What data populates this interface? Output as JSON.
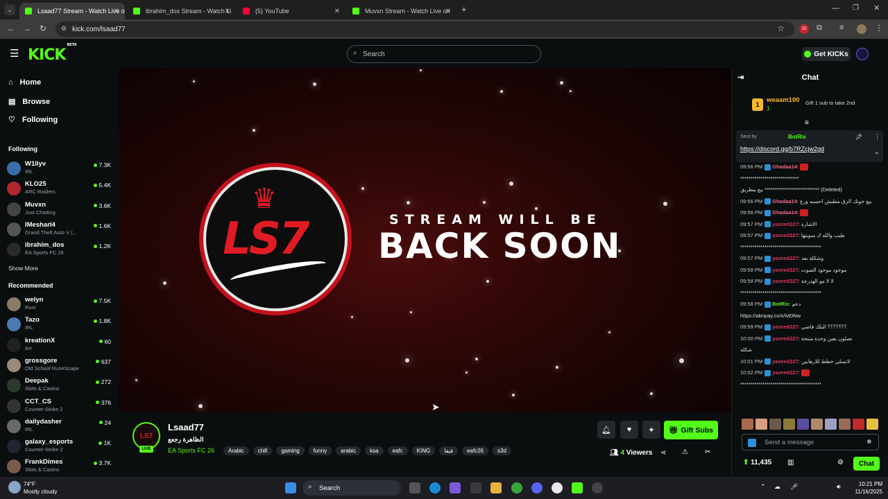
{
  "browser": {
    "tabs": [
      {
        "title": "Lsaad77 Stream - Watch Live o",
        "active": true,
        "favicon_color": "#53fc18"
      },
      {
        "title": "ibrahim_dos Stream - Watch Li",
        "active": false,
        "favicon_color": "#53fc18"
      },
      {
        "title": "(5) YouTube",
        "active": false,
        "favicon_color": "#ff0033"
      },
      {
        "title": "Muvxn Stream - Watch Live on",
        "active": false,
        "favicon_color": "#53fc18"
      }
    ],
    "url": "kick.com/lsaad77",
    "ext_badge": "20"
  },
  "header": {
    "logo": "KICK",
    "logo_sup": "BETA",
    "search_placeholder": "Search",
    "get_kicks": "Get KICKs"
  },
  "sidebar": {
    "nav": [
      {
        "label": "Home",
        "icon": "home-icon"
      },
      {
        "label": "Browse",
        "icon": "browse-icon"
      },
      {
        "label": "Following",
        "icon": "heart-icon"
      }
    ],
    "following_title": "Following",
    "following": [
      {
        "name": "W1llyv",
        "category": "IRL",
        "viewers": "7.3K",
        "color": "#3a6ea8"
      },
      {
        "name": "KLO25",
        "category": "ARC Raiders",
        "viewers": "5.4K",
        "color": "#b3262c"
      },
      {
        "name": "Muvxn",
        "category": "Just Chatting",
        "viewers": "3.6K",
        "color": "#444"
      },
      {
        "name": "IMesharI4",
        "category": "Grand Theft Auto V (...",
        "viewers": "1.6K",
        "color": "#555"
      },
      {
        "name": "ibrahim_dos",
        "category": "EA Sports FC 26",
        "viewers": "1.2K",
        "color": "#2a2a2a"
      }
    ],
    "show_more": "Show More",
    "recommended_title": "Recommended",
    "recommended": [
      {
        "name": "welyn",
        "category": "Rust",
        "viewers": "7.5K",
        "color": "#8a7a6a"
      },
      {
        "name": "Tazo",
        "category": "IRL",
        "viewers": "1.8K",
        "color": "#4a7ab0"
      },
      {
        "name": "kreationX",
        "category": "Art",
        "viewers": "60",
        "color": "#222"
      },
      {
        "name": "grossgore",
        "category": "Old School RuneScape",
        "viewers": "637",
        "color": "#9a8a7a"
      },
      {
        "name": "Deepak",
        "category": "Slots & Casino",
        "viewers": "272",
        "color": "#2b3a2b"
      },
      {
        "name": "CCT_CS",
        "category": "Counter-Strike 2",
        "viewers": "376",
        "color": "#333"
      },
      {
        "name": "dailydasher",
        "category": "IRL",
        "viewers": "24",
        "color": "#6a6a6a"
      },
      {
        "name": "galaxy_esports",
        "category": "Counter-Strike 2",
        "viewers": "1K",
        "color": "#223"
      },
      {
        "name": "FrankDimes",
        "category": "Slots & Casino",
        "viewers": "3.7K",
        "color": "#7a5a4a"
      }
    ]
  },
  "video": {
    "logo_text": "LS7",
    "line1": "STREAM WILL BE",
    "line2": "BACK SOON"
  },
  "stream": {
    "username": "Lsaad77",
    "title": "الظاهرة رجعع",
    "category": "EA Sports FC 26",
    "live": "LIVE",
    "tags": [
      "Arabic",
      "chill",
      "gaming",
      "funny",
      "arabic",
      "ksa",
      "eafc",
      "KING",
      "فيفا",
      "eafc26",
      "s3d"
    ],
    "viewers_count": "4",
    "viewers_label": "Viewers",
    "gift_subs": "Gift Subs"
  },
  "chat": {
    "title": "Chat",
    "top_gifter": {
      "rank": "1",
      "name": "weaam100",
      "count": "1",
      "hint": "Gift 1 sub to take 2nd"
    },
    "pinned": {
      "sent_by": "Sent by",
      "sender": "BotRix",
      "link": "https://discord.gg/b7RZcjw2gd"
    },
    "messages": [
      {
        "time": "09:56 PM",
        "user": "Ghadaa14",
        "text": "",
        "color": "#f56a8a"
      },
      {
        "time": "",
        "user": "",
        "text": "*****************************",
        "color": "#fff"
      },
      {
        "time": "",
        "user": "",
        "text": "بيع مطريق *************************** (Deleted)",
        "color": "#fff"
      },
      {
        "time": "09:56 PM",
        "user": "Ghadaa14",
        "text": "بيع خوتك الزق مطيش احسبه ورع",
        "color": "#f56a8a"
      },
      {
        "time": "09:56 PM",
        "user": "Ghadaa14",
        "text": "",
        "color": "#f56a8a"
      },
      {
        "time": "09:57 PM",
        "user": "yazeed227",
        "text": "الاشارة",
        "color": "#e0355a"
      },
      {
        "time": "09:57 PM",
        "user": "yazeed227",
        "text": "طيب والله ك سويتها",
        "color": "#e0355a"
      },
      {
        "time": "",
        "user": "",
        "text": "****************************************",
        "color": "#fff"
      },
      {
        "time": "09:57 PM",
        "user": "yazeed227",
        "text": "وشكلة بعد",
        "color": "#e0355a"
      },
      {
        "time": "09:58 PM",
        "user": "yazeed227",
        "text": "موجود موجود الصوت",
        "color": "#e0355a"
      },
      {
        "time": "09:58 PM",
        "user": "yazeed227",
        "text": "لا لا مو الهدرجة",
        "color": "#e0355a"
      },
      {
        "time": "",
        "user": "",
        "text": "****************************************",
        "color": "#fff"
      },
      {
        "time": "09:58 PM",
        "user": "BotRix",
        "text": "دعم",
        "color": "#53fc18"
      },
      {
        "time": "",
        "user": "",
        "text": "https://abnpay.co/s/lvt0Nw",
        "color": "#fff"
      },
      {
        "time": "09:59 PM",
        "user": "yazeed227",
        "text": "؟؟؟؟؟؟؟ البلك فاضي",
        "color": "#e0355a"
      },
      {
        "time": "10:00 PM",
        "user": "yazeed227",
        "text": "تصلون بعين وحدة منتحة",
        "color": "#e0355a"
      },
      {
        "time": "",
        "user": "",
        "text": "شكله",
        "color": "#fff"
      },
      {
        "time": "10:01 PM",
        "user": "yazeed227",
        "text": "لاتسلي خطط للارهابين",
        "color": "#e0355a"
      },
      {
        "time": "10:02 PM",
        "user": "yazeed227",
        "text": "",
        "color": "#e0355a"
      },
      {
        "time": "",
        "user": "",
        "text": "****************************************",
        "color": "#fff"
      }
    ],
    "input_placeholder": "Send a message",
    "kicks_balance": "11,435",
    "chat_button": "Chat"
  },
  "taskbar": {
    "weather_temp": "74°F",
    "weather_desc": "Mostly cloudy",
    "search": "Search",
    "time": "10:21 PM",
    "date": "11/16/2025"
  }
}
